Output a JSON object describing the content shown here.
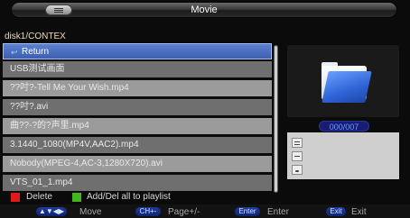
{
  "window": {
    "title": "Movie"
  },
  "path": "disk1/CONTEX",
  "files": [
    {
      "label": "Return",
      "selected": true,
      "icon": "return-arrow-icon"
    },
    {
      "label": "USB测试画面"
    },
    {
      "label": "??吋?-Tell Me Your Wish.mp4"
    },
    {
      "label": "??吋?.avi"
    },
    {
      "label": "曲??-?的?声里.mp4"
    },
    {
      "label": "3.1440_1080(MP4V,AAC2).mp4"
    },
    {
      "label": "Nobody(MPEG-4,AC-3,1280X720).avi"
    },
    {
      "label": "VTS_01_1.mp4"
    }
  ],
  "preview": {
    "counter": "000/007",
    "icon": "folder-icon"
  },
  "legend": {
    "delete": "Delete",
    "add_del": "Add/Del all to playlist",
    "red": "#e01a1a",
    "green": "#43b51f"
  },
  "hints": {
    "move_key": "▲▼◀▶",
    "move": "Move",
    "page_key": "CH+-",
    "page": "Page+/-",
    "enter_key": "Enter",
    "enter": "Enter",
    "exit_key": "Exit",
    "exit": "Exit"
  }
}
